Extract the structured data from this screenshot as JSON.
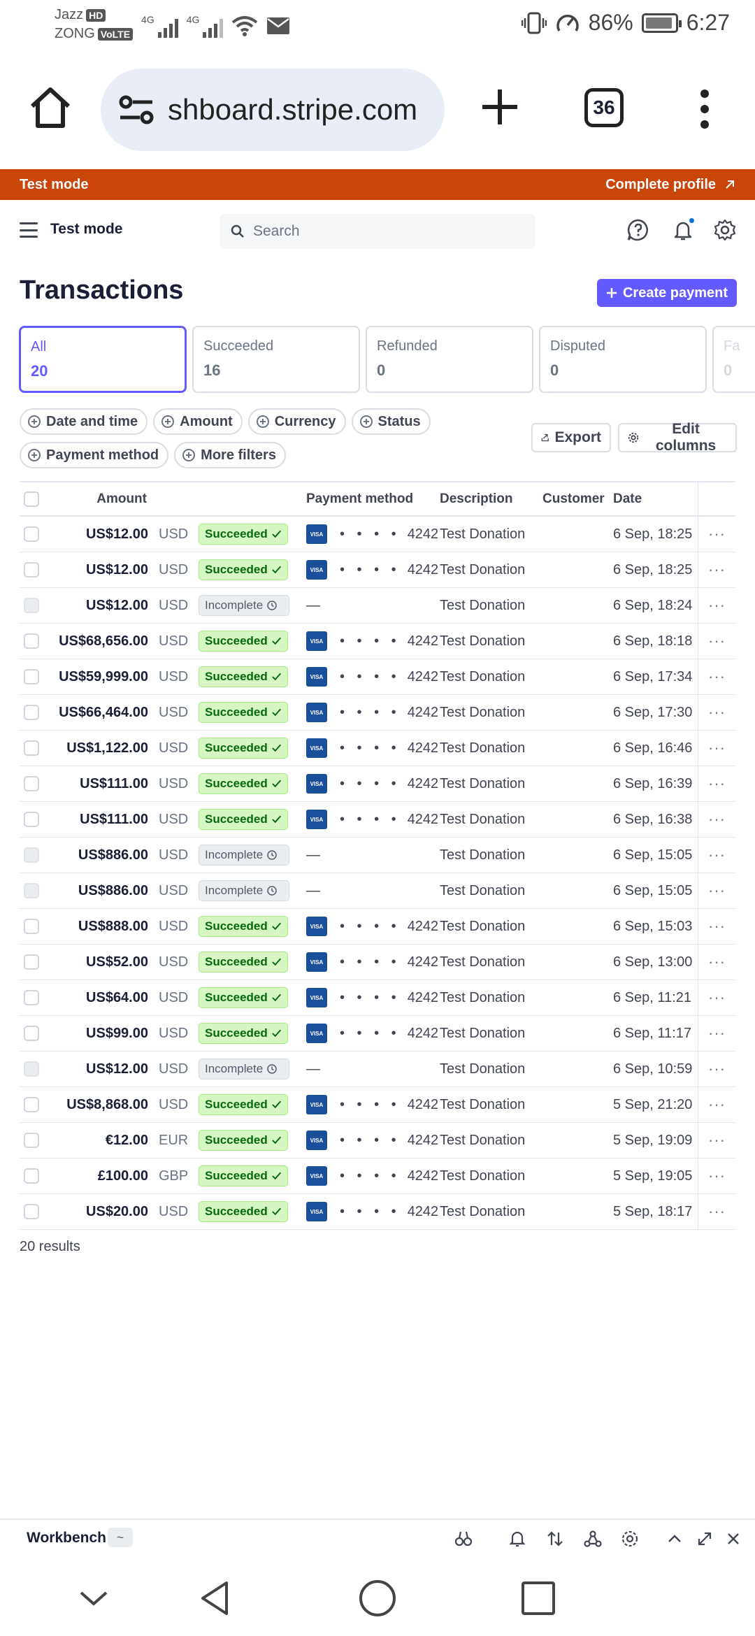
{
  "status_bar": {
    "carrier1": "Jazz",
    "carrier1_tag": "HD",
    "carrier2": "ZONG",
    "carrier2_tag": "VoLTE",
    "net1": "4G",
    "net2": "4G",
    "battery": "86%",
    "time": "6:27"
  },
  "browser": {
    "url": "shboard.stripe.com",
    "tab_count": "36"
  },
  "banner": {
    "label": "Test mode",
    "link": "Complete profile"
  },
  "topnav": {
    "title": "Test mode",
    "search_placeholder": "Search"
  },
  "page": {
    "title": "Transactions",
    "create_button": "Create payment"
  },
  "status_tabs": [
    {
      "label": "All",
      "count": "20"
    },
    {
      "label": "Succeeded",
      "count": "16"
    },
    {
      "label": "Refunded",
      "count": "0"
    },
    {
      "label": "Disputed",
      "count": "0"
    },
    {
      "label": "Fa",
      "count": "0"
    }
  ],
  "filters": [
    "Date and time",
    "Amount",
    "Currency",
    "Status",
    "Payment method",
    "More filters"
  ],
  "actions": {
    "export": "Export",
    "edit_columns": "Edit columns"
  },
  "table": {
    "headers": {
      "amount": "Amount",
      "payment_method": "Payment method",
      "description": "Description",
      "customer": "Customer",
      "date": "Date"
    },
    "rows": [
      {
        "amount": "US$12.00",
        "currency": "USD",
        "status": "Succeeded",
        "card": "4242",
        "description": "Test Donation",
        "date": "6 Sep, 18:25"
      },
      {
        "amount": "US$12.00",
        "currency": "USD",
        "status": "Succeeded",
        "card": "4242",
        "description": "Test Donation",
        "date": "6 Sep, 18:25"
      },
      {
        "amount": "US$12.00",
        "currency": "USD",
        "status": "Incomplete",
        "card": "",
        "description": "Test Donation",
        "date": "6 Sep, 18:24"
      },
      {
        "amount": "US$68,656.00",
        "currency": "USD",
        "status": "Succeeded",
        "card": "4242",
        "description": "Test Donation",
        "date": "6 Sep, 18:18"
      },
      {
        "amount": "US$59,999.00",
        "currency": "USD",
        "status": "Succeeded",
        "card": "4242",
        "description": "Test Donation",
        "date": "6 Sep, 17:34"
      },
      {
        "amount": "US$66,464.00",
        "currency": "USD",
        "status": "Succeeded",
        "card": "4242",
        "description": "Test Donation",
        "date": "6 Sep, 17:30"
      },
      {
        "amount": "US$1,122.00",
        "currency": "USD",
        "status": "Succeeded",
        "card": "4242",
        "description": "Test Donation",
        "date": "6 Sep, 16:46"
      },
      {
        "amount": "US$111.00",
        "currency": "USD",
        "status": "Succeeded",
        "card": "4242",
        "description": "Test Donation",
        "date": "6 Sep, 16:39"
      },
      {
        "amount": "US$111.00",
        "currency": "USD",
        "status": "Succeeded",
        "card": "4242",
        "description": "Test Donation",
        "date": "6 Sep, 16:38"
      },
      {
        "amount": "US$886.00",
        "currency": "USD",
        "status": "Incomplete",
        "card": "",
        "description": "Test Donation",
        "date": "6 Sep, 15:05"
      },
      {
        "amount": "US$886.00",
        "currency": "USD",
        "status": "Incomplete",
        "card": "",
        "description": "Test Donation",
        "date": "6 Sep, 15:05"
      },
      {
        "amount": "US$888.00",
        "currency": "USD",
        "status": "Succeeded",
        "card": "4242",
        "description": "Test Donation",
        "date": "6 Sep, 15:03"
      },
      {
        "amount": "US$52.00",
        "currency": "USD",
        "status": "Succeeded",
        "card": "4242",
        "description": "Test Donation",
        "date": "6 Sep, 13:00"
      },
      {
        "amount": "US$64.00",
        "currency": "USD",
        "status": "Succeeded",
        "card": "4242",
        "description": "Test Donation",
        "date": "6 Sep, 11:21"
      },
      {
        "amount": "US$99.00",
        "currency": "USD",
        "status": "Succeeded",
        "card": "4242",
        "description": "Test Donation",
        "date": "6 Sep, 11:17"
      },
      {
        "amount": "US$12.00",
        "currency": "USD",
        "status": "Incomplete",
        "card": "",
        "description": "Test Donation",
        "date": "6 Sep, 10:59"
      },
      {
        "amount": "US$8,868.00",
        "currency": "USD",
        "status": "Succeeded",
        "card": "4242",
        "description": "Test Donation",
        "date": "5 Sep, 21:20"
      },
      {
        "amount": "€12.00",
        "currency": "EUR",
        "status": "Succeeded",
        "card": "4242",
        "description": "Test Donation",
        "date": "5 Sep, 19:09"
      },
      {
        "amount": "£100.00",
        "currency": "GBP",
        "status": "Succeeded",
        "card": "4242",
        "description": "Test Donation",
        "date": "5 Sep, 19:05"
      },
      {
        "amount": "US$20.00",
        "currency": "USD",
        "status": "Succeeded",
        "card": "4242",
        "description": "Test Donation",
        "date": "5 Sep, 18:17"
      }
    ],
    "card_brand": "VISA",
    "card_mask": "• • • •",
    "empty_mark": "—",
    "results": "20 results"
  },
  "workbench": {
    "title": "Workbench",
    "tag": "~"
  },
  "colors": {
    "accent": "#635bff",
    "banner": "#c9450a",
    "success_bg": "#d7f7c2",
    "success_fg": "#05690d"
  }
}
